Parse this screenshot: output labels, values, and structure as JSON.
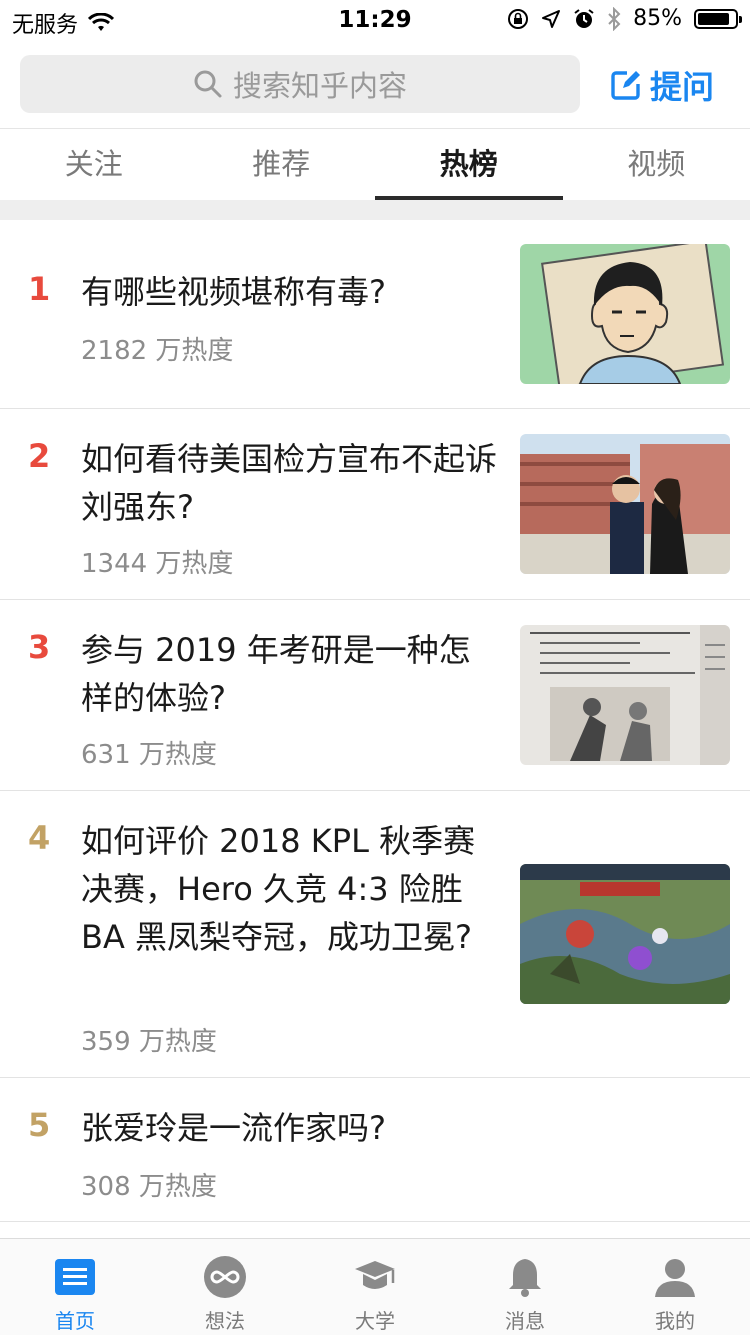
{
  "status_bar": {
    "carrier": "无服务",
    "time": "11:29",
    "battery_percent": "85%",
    "battery_level": 0.85
  },
  "header": {
    "search_placeholder": "搜索知乎内容",
    "ask_label": "提问"
  },
  "tabs": [
    {
      "label": "关注"
    },
    {
      "label": "推荐"
    },
    {
      "label": "热榜"
    },
    {
      "label": "视频"
    }
  ],
  "hot_list": [
    {
      "rank": "1",
      "title": "有哪些视频堪称有毒?",
      "heat": "2182 万热度"
    },
    {
      "rank": "2",
      "title": "如何看待美国检方宣布不起诉刘强东?",
      "heat": "1344 万热度"
    },
    {
      "rank": "3",
      "title": "参与 2019 年考研是一种怎样的体验?",
      "heat": "631 万热度"
    },
    {
      "rank": "4",
      "title": "如何评价 2018 KPL 秋季赛决赛，Hero 久竞 4:3 险胜 BA 黑凤梨夺冠，成功卫冕?",
      "heat": "359 万热度"
    },
    {
      "rank": "5",
      "title": "张爱玲是一流作家吗?",
      "heat": "308 万热度"
    }
  ],
  "bottom_nav": [
    {
      "label": "首页"
    },
    {
      "label": "想法"
    },
    {
      "label": "大学"
    },
    {
      "label": "消息"
    },
    {
      "label": "我的"
    }
  ],
  "colors": {
    "accent": "#1a86f0",
    "rank_top": "#e84a3d",
    "rank_other": "#c2a265"
  }
}
